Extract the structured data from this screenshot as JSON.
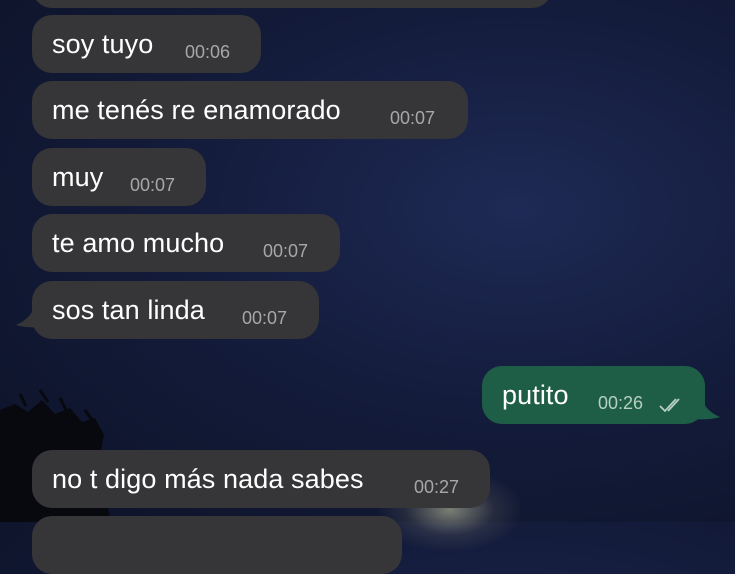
{
  "messages": [
    {
      "direction": "incoming",
      "text": "soy tuyo",
      "time": "00:06"
    },
    {
      "direction": "incoming",
      "text": "me tenés re enamorado",
      "time": "00:07"
    },
    {
      "direction": "incoming",
      "text": "muy",
      "time": "00:07"
    },
    {
      "direction": "incoming",
      "text": "te amo mucho",
      "time": "00:07"
    },
    {
      "direction": "incoming",
      "text": "sos tan linda",
      "time": "00:07"
    },
    {
      "direction": "outgoing",
      "text": "putito",
      "time": "00:26",
      "status_icon": "double-check-icon"
    },
    {
      "direction": "incoming",
      "text": "no t digo más nada sabes",
      "time": "00:27"
    }
  ],
  "colors": {
    "incoming_bubble": "#363638",
    "outgoing_bubble": "#1f5e46",
    "background": "#141c3c"
  }
}
